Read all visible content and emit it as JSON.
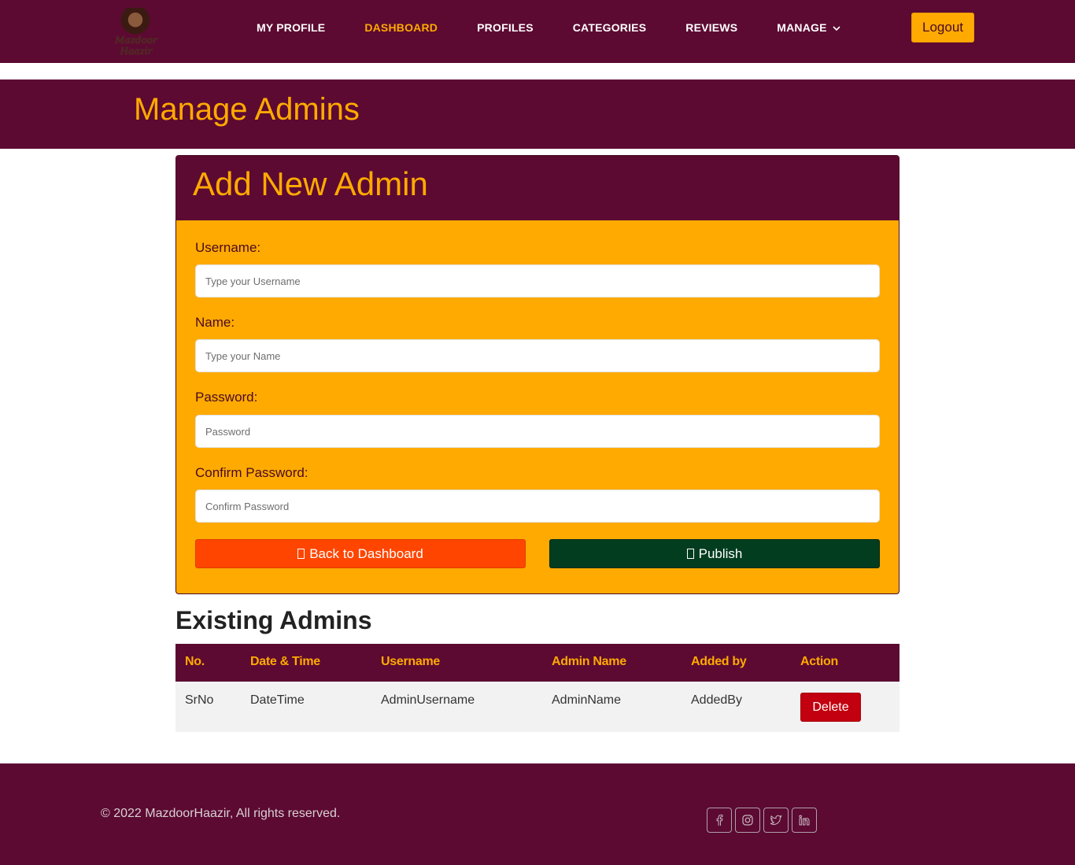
{
  "brand": {
    "logo_text": "Mazdoor Haazir"
  },
  "nav": {
    "items": [
      {
        "label": "MY PROFILE"
      },
      {
        "label": "DASHBOARD"
      },
      {
        "label": "PROFILES"
      },
      {
        "label": "CATEGORIES"
      },
      {
        "label": "REVIEWS"
      },
      {
        "label": "MANAGE"
      }
    ],
    "active": "DASHBOARD",
    "logout_label": "Logout"
  },
  "page": {
    "title": "Manage Admins"
  },
  "form": {
    "title": "Add New Admin",
    "fields": [
      {
        "label": "Username:",
        "placeholder": "Type your Username",
        "value": ""
      },
      {
        "label": "Name:",
        "placeholder": "Type your Name",
        "value": ""
      },
      {
        "label": "Password:",
        "placeholder": "Password",
        "value": ""
      },
      {
        "label": "Confirm Password:",
        "placeholder": "Confirm Password",
        "value": ""
      }
    ],
    "back_label": "Back to Dashboard",
    "publish_label": "Publish"
  },
  "admins": {
    "title": "Existing Admins",
    "columns": [
      "No.",
      "Date & Time",
      "Username",
      "Admin Name",
      "Added by",
      "Action"
    ],
    "rows": [
      {
        "no": "SrNo",
        "datetime": "DateTime",
        "username": "AdminUsername",
        "admin_name": "AdminName",
        "added_by": "AddedBy",
        "action": "Delete"
      }
    ]
  },
  "footer": {
    "copyright": "© 2022 MazdoorHaazir, All rights reserved.",
    "socials": [
      "facebook-icon",
      "instagram-icon",
      "twitter-icon",
      "linkedin-icon"
    ]
  },
  "colors": {
    "brand_maroon": "#5c0a32",
    "accent_orange": "#ffaa00",
    "back_button": "#ff4500",
    "publish_button": "#033d20",
    "delete_button": "#c2000f"
  }
}
